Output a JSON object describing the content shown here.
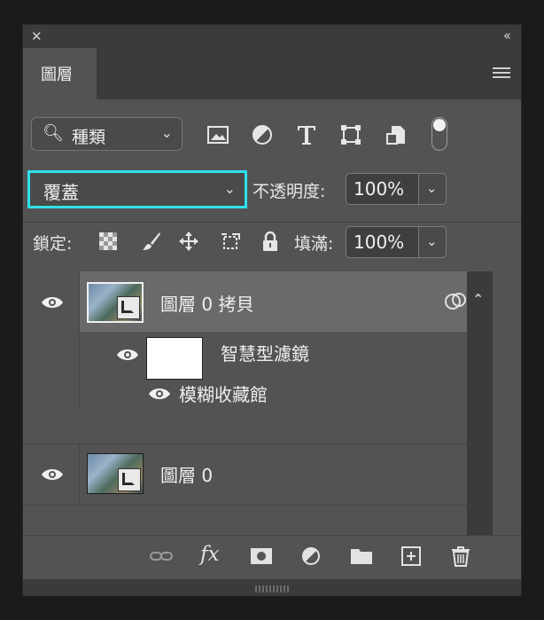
{
  "panel": {
    "tab_label": "圖層"
  },
  "filter": {
    "label": "種類",
    "icons": [
      "image-filter-icon",
      "adjustment-filter-icon",
      "type-filter-icon",
      "shape-filter-icon",
      "smart-object-filter-icon"
    ],
    "toggle_on": true
  },
  "blend": {
    "mode": "覆蓋",
    "opacity_label": "不透明度:",
    "opacity_value": "100%"
  },
  "lock": {
    "label": "鎖定:",
    "fill_label": "填滿:",
    "fill_value": "100%"
  },
  "layers": [
    {
      "name": "圖層 0 拷貝",
      "selected": true,
      "has_filters": true
    },
    {
      "filter_mask_name": "智慧型濾鏡"
    },
    {
      "filter_name": "模糊收藏館"
    },
    {
      "name": "圖層 0",
      "selected": false
    }
  ],
  "colors": {
    "accent": "#2de2ee",
    "panel_bg": "#535353",
    "selected_row": "#6a6a6a"
  }
}
